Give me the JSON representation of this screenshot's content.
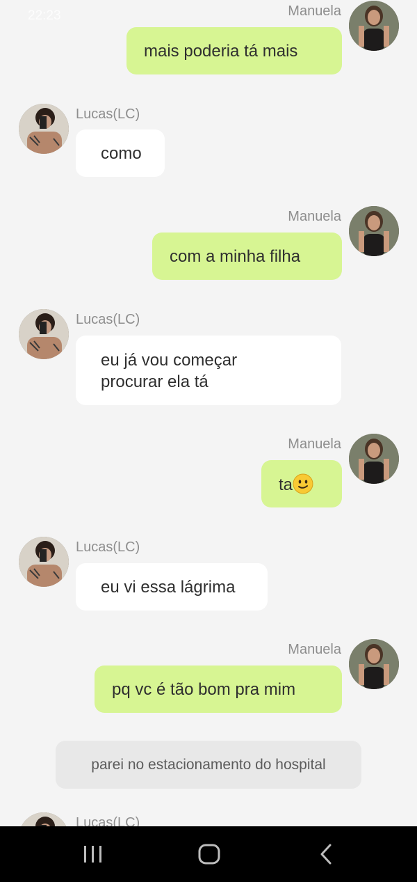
{
  "status_bar": {
    "time": "22:23"
  },
  "messages": [
    {
      "sender": "Manuela",
      "direction": "out",
      "lines": [
        "mais poderia tá mais"
      ]
    },
    {
      "sender": "Lucas(LC)",
      "direction": "in",
      "lines": [
        "como"
      ]
    },
    {
      "sender": "Manuela",
      "direction": "out",
      "lines": [
        "com a minha filha"
      ]
    },
    {
      "sender": "Lucas(LC)",
      "direction": "in",
      "lines": [
        "eu já vou começar",
        "procurar ela tá"
      ]
    },
    {
      "sender": "Manuela",
      "direction": "out",
      "lines": [
        "ta"
      ],
      "emoji": "slightly-smiling-face-icon"
    },
    {
      "sender": "Lucas(LC)",
      "direction": "in",
      "lines": [
        "eu vi essa lágrima"
      ]
    },
    {
      "sender": "Manuela",
      "direction": "out",
      "lines": [
        "pq vc é tão bom pra mim"
      ]
    }
  ],
  "notice": "parei no estacionamento  do hospital",
  "partial_message": {
    "sender": "Lucas(LC)"
  },
  "nav_bar": {
    "buttons": [
      "recent-apps-icon",
      "home-icon",
      "back-icon"
    ]
  },
  "colors": {
    "outgoing_bubble": "#d7f593",
    "incoming_bubble": "#ffffff",
    "background": "#f4f4f4",
    "nav_bar": "#000000"
  }
}
